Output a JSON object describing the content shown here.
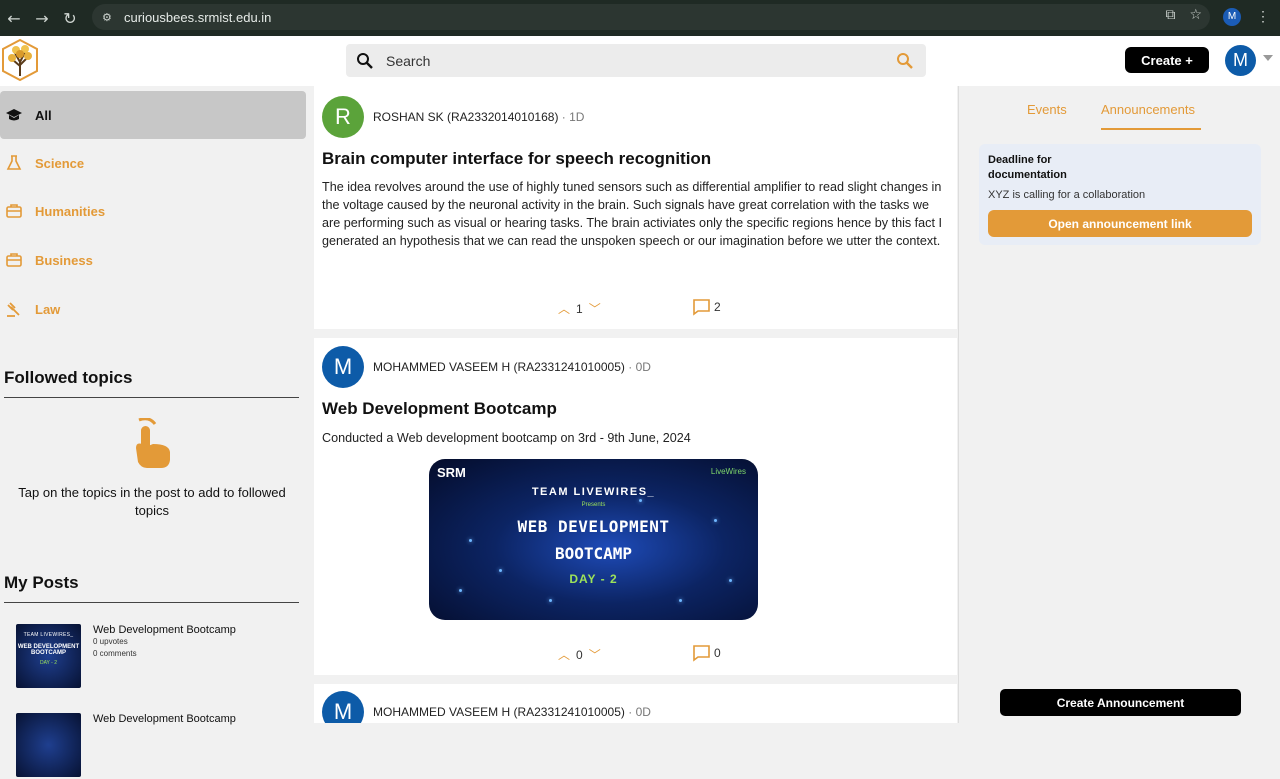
{
  "browser": {
    "url": "curiousbees.srmist.edu.in",
    "profile_initial": "M"
  },
  "header": {
    "search_placeholder": "Search",
    "create_label": "Create +",
    "avatar_initial": "M"
  },
  "sidebar": {
    "categories": [
      {
        "label": "All",
        "active": true
      },
      {
        "label": "Science",
        "active": false
      },
      {
        "label": "Humanities",
        "active": false
      },
      {
        "label": "Business",
        "active": false
      },
      {
        "label": "Law",
        "active": false
      }
    ],
    "followed_title": "Followed topics",
    "followed_hint": "Tap on the topics in the post to add to followed topics",
    "my_posts_title": "My Posts",
    "my_posts": [
      {
        "title": "Web Development Bootcamp",
        "upvotes": "0 upvotes",
        "comments": "0 comments",
        "thumb_line1": "TEAM LIVEWIRES_",
        "thumb_line2": "WEB DEVELOPMENT BOOTCAMP",
        "thumb_line3": "DAY - 2"
      },
      {
        "title": "Web Development Bootcamp"
      }
    ]
  },
  "feed": {
    "posts": [
      {
        "avatar": "R",
        "avatar_color": "#5ba33a",
        "author": "ROSHAN SK (RA2332014010168)",
        "age": "· 1D",
        "title": "Brain computer interface for speech recognition",
        "body": "The idea revolves around the use of highly tuned sensors such as differential amplifier to read slight changes in the voltage caused by the neuronal activity in the brain. Such signals have great correlation with the tasks we are performing such as visual or hearing tasks. The brain activiates only the specific regions hence by this fact I generated an hypothesis that we can read the unspoken speech or our imagination before we utter the context.",
        "votes": "1",
        "comments": "2"
      },
      {
        "avatar": "M",
        "avatar_color": "#0d5ba8",
        "author": "MOHAMMED VASEEM H (RA2331241010005)",
        "age": "· 0D",
        "title": "Web Development Bootcamp",
        "body": "Conducted a Web development bootcamp on 3rd - 9th June, 2024",
        "banner": {
          "org": "SRM",
          "team": "TEAM LIVEWIRES_",
          "presents": "Presents",
          "line1": "WEB DEVELOPMENT",
          "line2": "BOOTCAMP",
          "day": "DAY - 2",
          "logo": "LiveWires"
        },
        "votes": "0",
        "comments": "0"
      },
      {
        "avatar": "M",
        "avatar_color": "#0d5ba8",
        "author": "MOHAMMED VASEEM H (RA2331241010005)",
        "age": "· 0D"
      }
    ]
  },
  "right": {
    "tabs": [
      "Events",
      "Announcements"
    ],
    "active_tab": "Announcements",
    "announcement": {
      "title": "Deadline for documentation",
      "desc": "XYZ is calling for a collaboration",
      "button": "Open announcement link"
    },
    "create_button": "Create Announcement"
  },
  "colors": {
    "accent": "#e39a38",
    "primary_dark": "#000000",
    "avatar_blue": "#0d5ba8",
    "avatar_green": "#5ba33a"
  }
}
